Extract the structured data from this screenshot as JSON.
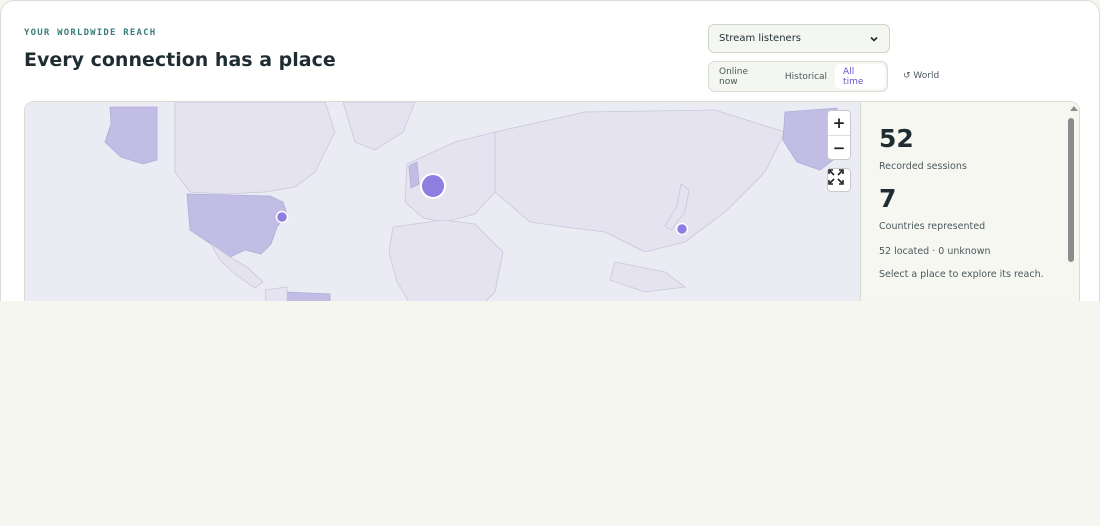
{
  "header": {
    "eyebrow": "YOUR WORLDWIDE REACH",
    "title": "Every connection has a place"
  },
  "metric_select": {
    "selected": "Stream listeners"
  },
  "time_filter": {
    "options": [
      "Online now",
      "Historical",
      "All time"
    ],
    "active": "All time"
  },
  "world_link": {
    "label": "↺ World"
  },
  "map": {
    "highlight_color": "#c2bde5",
    "land_color": "#e4e3ef",
    "water_color": "#ebebf4",
    "marker_color": "#8d7fe0",
    "markers": [
      {
        "name": "Europe",
        "lon": 6.5,
        "lat": 51.0,
        "size": "large"
      },
      {
        "name": "United States East",
        "lon": -73.5,
        "lat": 40.7,
        "size": "small"
      },
      {
        "name": "Japan",
        "lon": 139.7,
        "lat": 35.6,
        "size": "small"
      }
    ],
    "highlighted_regions": [
      "Alaska",
      "United States",
      "United Kingdom",
      "Brazil"
    ]
  },
  "controls": {
    "zoom_in": "+",
    "zoom_out": "−",
    "fullscreen_icon": "expand-icon"
  },
  "stats": {
    "sessions_value": "52",
    "sessions_label": "Recorded sessions",
    "countries_value": "7",
    "countries_label": "Countries represented",
    "located_line": "52 located · 0 unknown",
    "hint": "Select a place to explore its reach."
  }
}
